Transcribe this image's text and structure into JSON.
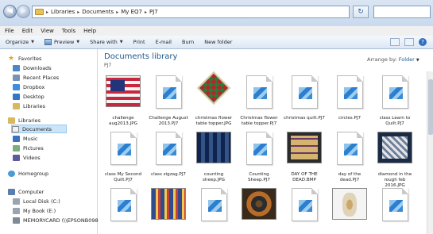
{
  "address": {
    "crumbs": [
      "Libraries",
      "Documents",
      "My EQ7",
      "PJ7"
    ],
    "search_placeholder": ""
  },
  "menu": [
    "File",
    "Edit",
    "View",
    "Tools",
    "Help"
  ],
  "toolbar": {
    "organize": "Organize",
    "preview": "Preview",
    "share_with": "Share with",
    "print": "Print",
    "email": "E-mail",
    "burn": "Burn",
    "new_folder": "New folder"
  },
  "nav": {
    "favorites": "Favorites",
    "downloads": "Downloads",
    "recent_places": "Recent Places",
    "dropbox": "Dropbox",
    "desktop": "Desktop",
    "libraries_fav": "Libraries",
    "libraries": "Libraries",
    "documents": "Documents",
    "music": "Music",
    "pictures": "Pictures",
    "videos": "Videos",
    "homegroup": "Homegroup",
    "computer": "Computer",
    "local_disk": "Local Disk (C:)",
    "my_book": "My Book (E:)",
    "memorycard": "MEMORYCARD (\\\\EPSONB098"
  },
  "library": {
    "title": "Documents library",
    "subtitle": "PJ7",
    "arrange_label": "Arrange by:",
    "arrange_value": "Folder"
  },
  "files": [
    {
      "name": "challenge aug2013.JPG",
      "kind": "photo",
      "style": "p-challenge"
    },
    {
      "name": "Challenge August 2013.PJ7",
      "kind": "doc"
    },
    {
      "name": "christmas flower table topper.JPG",
      "kind": "xmas"
    },
    {
      "name": "Christmas flower table topper.PJ7",
      "kind": "doc"
    },
    {
      "name": "christmas quilt.PJ7",
      "kind": "doc"
    },
    {
      "name": "circles.PJ7",
      "kind": "doc"
    },
    {
      "name": "class Learn to Quilt.PJ7",
      "kind": "doc"
    },
    {
      "name": "class My Second Quilt.PJ7",
      "kind": "doc"
    },
    {
      "name": "class zigzag.PJ7",
      "kind": "doc"
    },
    {
      "name": "counting sheep.JPG",
      "kind": "photo",
      "style": "p-sheep"
    },
    {
      "name": "Counting Sheep.PJ7",
      "kind": "doc"
    },
    {
      "name": "DAY OF THE DEAD.BMP",
      "kind": "photo",
      "style": "p-dead"
    },
    {
      "name": "day of the dead.PJ7",
      "kind": "doc"
    },
    {
      "name": "diamond in the rough feb 2016.JPG",
      "kind": "photo",
      "style": "p-rough"
    },
    {
      "name": "",
      "kind": "doc"
    },
    {
      "name": "",
      "kind": "photo",
      "style": "p-row3a"
    },
    {
      "name": "",
      "kind": "doc"
    },
    {
      "name": "",
      "kind": "photo",
      "style": "p-row3b"
    },
    {
      "name": "",
      "kind": "doc"
    },
    {
      "name": "",
      "kind": "photo",
      "style": "p-row3c"
    },
    {
      "name": "",
      "kind": "doc"
    }
  ]
}
